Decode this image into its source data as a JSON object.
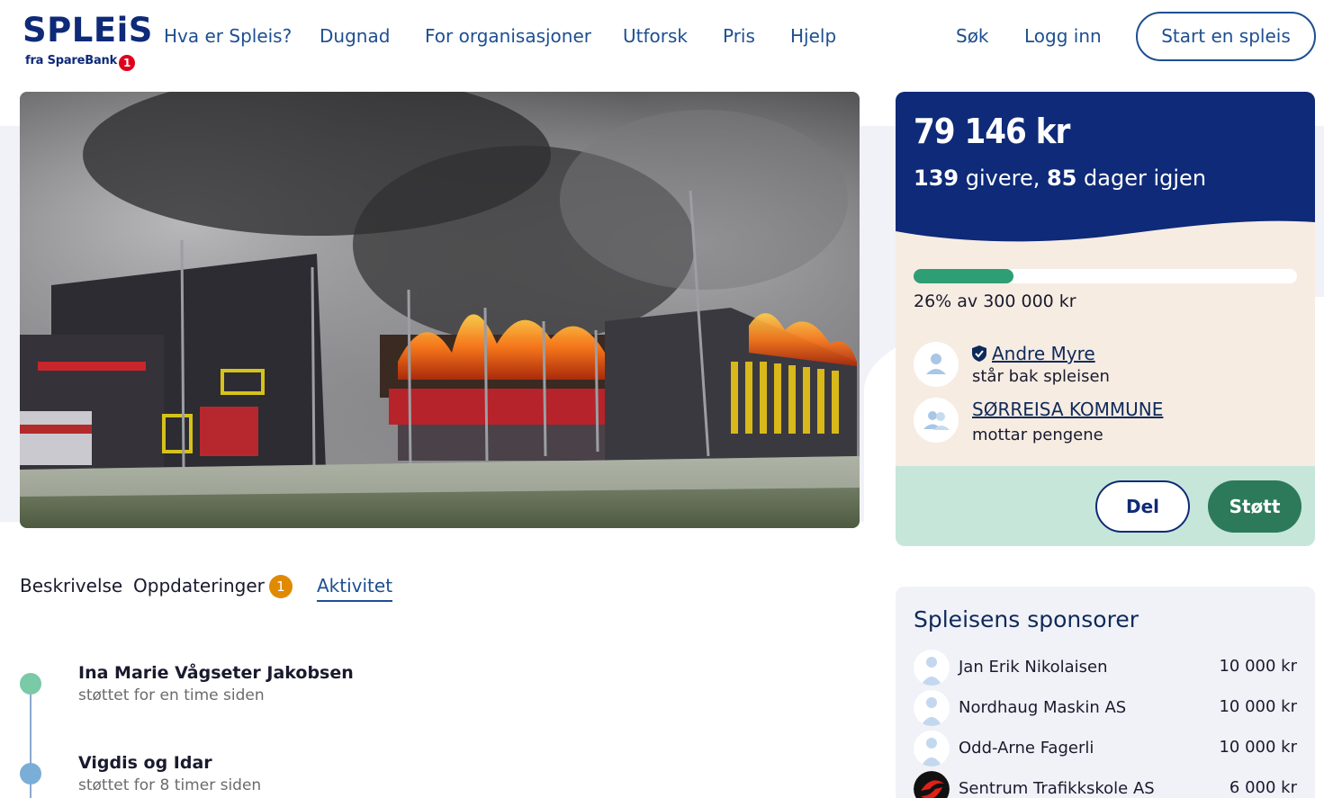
{
  "header": {
    "logo_word": "SPLEiS",
    "logo_sub": "fra SpareBank",
    "logo_badge": "1",
    "nav": [
      "Hva er Spleis?",
      "Dugnad",
      "For organisasjoner",
      "Utforsk",
      "Pris",
      "Hjelp"
    ],
    "search_label": "Søk",
    "login_label": "Logg inn",
    "start_label": "Start en spleis"
  },
  "campaign": {
    "amount": "79 146 kr",
    "givers_count": "139",
    "givers_label": "givere,",
    "days_count": "85",
    "days_label": "dager igjen",
    "progress_fraction": 0.26,
    "progress_text": "26% av 300 000 kr",
    "organizer_name": "Andre Myre",
    "organizer_role": "står bak spleisen",
    "recipient_name": "SØRREISA KOMMUNE",
    "recipient_role": "mottar pengene",
    "share_label": "Del",
    "support_label": "Støtt"
  },
  "tabs": [
    {
      "label": "Beskrivelse",
      "active": false
    },
    {
      "label": "Oppdateringer",
      "badge": "1",
      "active": false
    },
    {
      "label": "Aktivitet",
      "active": true
    }
  ],
  "activity": [
    {
      "name": "Ina Marie Vågseter Jakobsen",
      "time": "støttet for en time siden",
      "color": "#7ac9a7"
    },
    {
      "name": "Vigdis og Idar",
      "time": "støttet for 8 timer siden",
      "color": "#7aaed6"
    }
  ],
  "sponsors": {
    "title": "Spleisens sponsorer",
    "items": [
      {
        "name": "Jan Erik Nikolaisen",
        "amount": "10 000 kr"
      },
      {
        "name": "Nordhaug Maskin AS",
        "amount": "10 000 kr"
      },
      {
        "name": "Odd-Arne Fagerli",
        "amount": "10 000 kr"
      },
      {
        "name": "Sentrum Trafikkskole AS",
        "amount": "6 000 kr"
      }
    ]
  },
  "colors": {
    "brand_navy": "#0e2a78",
    "link_blue": "#1d4f91",
    "progress_green": "#2e9e74",
    "support_green": "#2c7a5a",
    "badge_orange": "#e08a00"
  }
}
